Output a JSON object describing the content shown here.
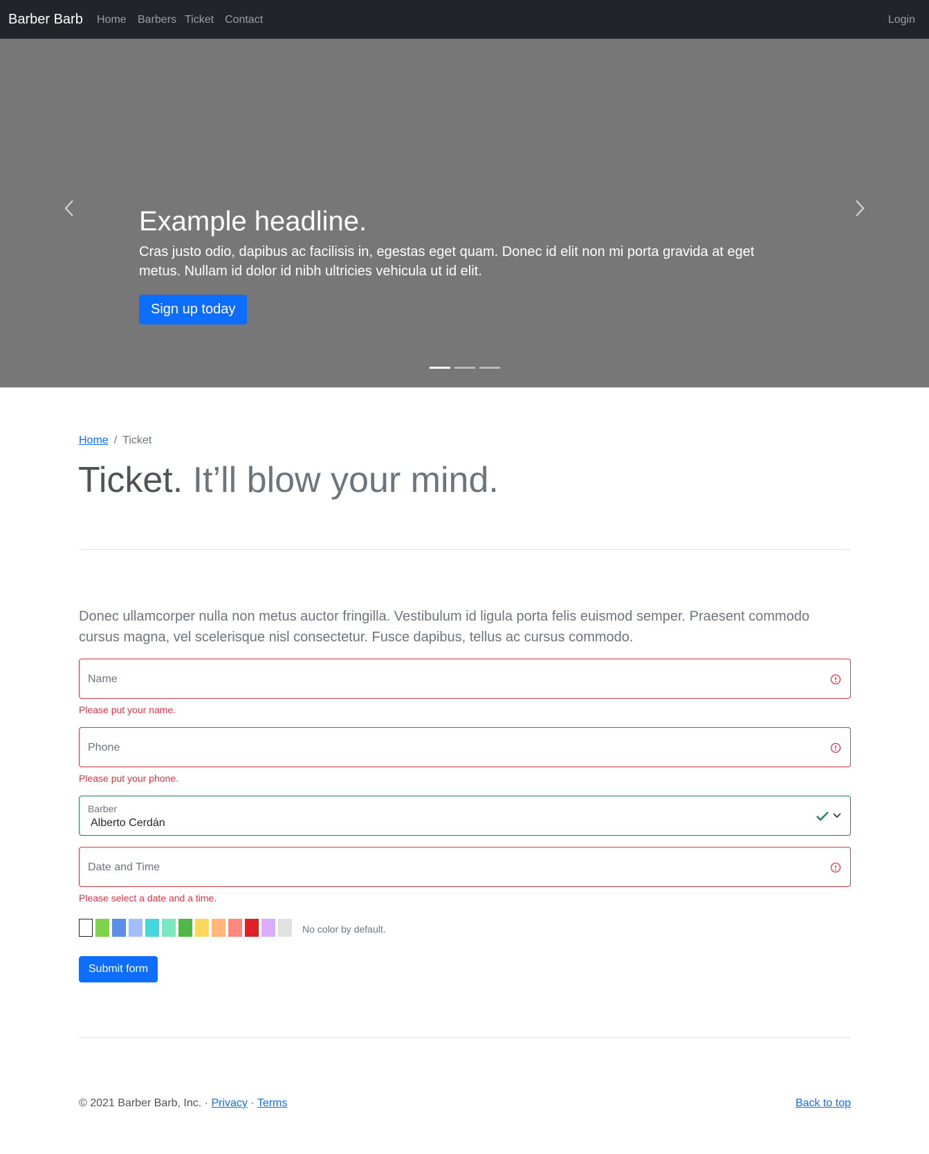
{
  "navbar": {
    "brand": "Barber Barb",
    "links": [
      "Home",
      "Barbers",
      "Ticket",
      "Contact"
    ],
    "login": "Login"
  },
  "carousel": {
    "title": "Example headline.",
    "text": "Cras justo odio, dapibus ac facilisis in, egestas eget quam. Donec id elit non mi porta gravida at eget metus. Nullam id dolor id nibh ultricies vehicula ut id elit.",
    "button": "Sign up today",
    "slide_count": 3,
    "active_slide": 1,
    "background_color": "#777777"
  },
  "breadcrumb": {
    "home": "Home",
    "separator": "/",
    "current": "Ticket"
  },
  "heading": {
    "main": "Ticket.",
    "muted": "It’ll blow your mind."
  },
  "lead": "Donec ullamcorper nulla non metus auctor fringilla. Vestibulum id ligula porta felis euismod semper. Praesent commodo cursus magna, vel scelerisque nisl consectetur. Fusce dapibus, tellus ac cursus commodo.",
  "form": {
    "name": {
      "placeholder": "Name",
      "error": "Please put your name."
    },
    "phone": {
      "placeholder": "Phone",
      "error": "Please put your phone."
    },
    "barber": {
      "label": "Barber",
      "value": "Alberto Cerdán"
    },
    "datetime": {
      "placeholder": "Date and Time",
      "error": "Please select a date and a time."
    },
    "colors": [
      "#ffffff",
      "#7ed34a",
      "#5c8fe8",
      "#a4bdfc",
      "#46d6db",
      "#7ae7bf",
      "#51b749",
      "#fbd75b",
      "#ffb878",
      "#ff887c",
      "#dc2127",
      "#dbadff",
      "#e1e1e1"
    ],
    "color_help": "No color by default.",
    "submit": "Submit form"
  },
  "footer": {
    "copyright": "© 2021 Barber Barb, Inc. · ",
    "privacy": "Privacy",
    "dot": " · ",
    "terms": "Terms",
    "back_to_top": "Back to top"
  },
  "theme": {
    "primary": "#0d6efd",
    "danger": "#dc3545",
    "success": "#198754",
    "navbar_bg": "#212529"
  }
}
